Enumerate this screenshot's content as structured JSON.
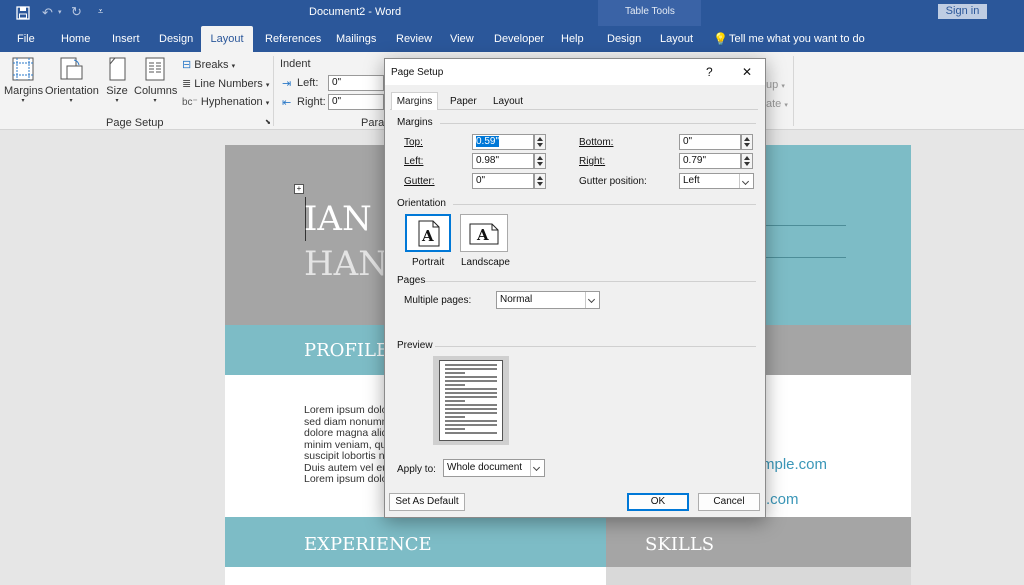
{
  "titlebar": {
    "title": "Document2  -  Word",
    "table_tools": "Table Tools",
    "sign_in": "Sign in",
    "bg": "#2b579a"
  },
  "tabs": [
    "File",
    "Home",
    "Insert",
    "Design",
    "Layout",
    "References",
    "Mailings",
    "Review",
    "View",
    "Developer",
    "Help",
    "Design",
    "Layout"
  ],
  "tell_me": "Tell me what you want to do",
  "ribbon": {
    "margins": "Margins",
    "orientation": "Orientation",
    "size": "Size",
    "columns": "Columns",
    "breaks": "Breaks",
    "line_numbers": "Line Numbers",
    "hyphenation": "Hyphenation",
    "group_page_setup": "Page Setup",
    "indent": "Indent",
    "left": "Left:",
    "right": "Right:",
    "left_val": "0\"",
    "right_val": "0\"",
    "group_para": "Parag",
    "after": "up",
    "arrange": "ate"
  },
  "document": {
    "name1": "IAN",
    "name2": "HAN",
    "profile": "PROFILE",
    "experience": "EXPERIENCE",
    "skills": "SKILLS",
    "lorem_lines": [
      "Lorem ipsum dolo",
      "sed diam nonumm",
      "dolore magna aliq",
      "minim veniam, qu",
      "suscipit lobortis ni",
      "Duis autem vel eu",
      "Lorem ipsum dolo"
    ],
    "email1": "mple.com",
    "email2": ".com",
    "colors": {
      "gray": "#a5a5a5",
      "teal": "#7dbcc6",
      "teal_light": "#a6d3da"
    }
  },
  "dialog": {
    "title": "Page Setup",
    "help": "?",
    "close": "✕",
    "tabs": [
      "Margins",
      "Paper",
      "Layout"
    ],
    "margins_section": "Margins",
    "top_label": "Top:",
    "top_val": "0.59\"",
    "bottom_label": "Bottom:",
    "bottom_val": "0\"",
    "left_label": "Left:",
    "left_val": "0.98\"",
    "right_label": "Right:",
    "right_val": "0.79\"",
    "gutter_label": "Gutter:",
    "gutter_val": "0\"",
    "gutter_pos_label": "Gutter position:",
    "gutter_pos_val": "Left",
    "orientation_section": "Orientation",
    "portrait": "Portrait",
    "landscape": "Landscape",
    "pages_section": "Pages",
    "multiple_pages_label": "Multiple pages:",
    "multiple_pages_val": "Normal",
    "preview_section": "Preview",
    "apply_to_label": "Apply to:",
    "apply_to_val": "Whole document",
    "set_default": "Set As Default",
    "ok": "OK",
    "cancel": "Cancel"
  }
}
